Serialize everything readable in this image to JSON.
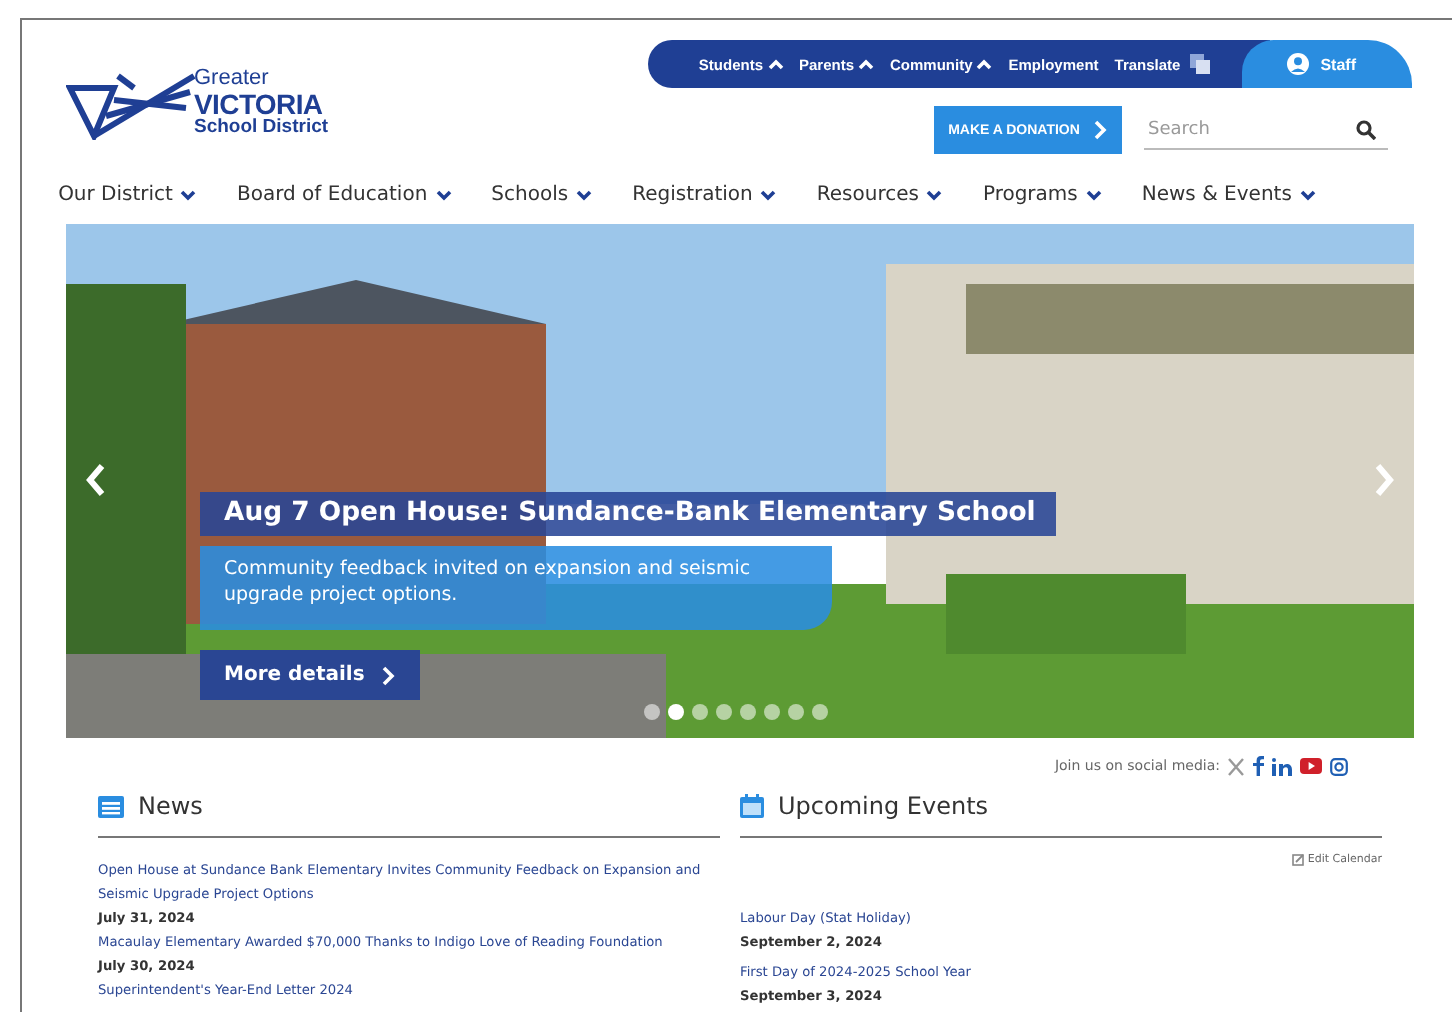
{
  "logo": {
    "line1": "Greater",
    "line2": "VICTORIA",
    "line3": "School District"
  },
  "top_links": [
    {
      "label": "Students",
      "caret": true
    },
    {
      "label": "Parents",
      "caret": true
    },
    {
      "label": "Community",
      "caret": true
    },
    {
      "label": "Employment",
      "caret": false
    },
    {
      "label": "Translate",
      "caret": false
    }
  ],
  "staff_link": "Staff",
  "donate_button": "MAKE A DONATION",
  "search": {
    "placeholder": "Search"
  },
  "main_nav": [
    "Our District",
    "Board of Education",
    "Schools",
    "Registration",
    "Resources",
    "Programs",
    "News & Events"
  ],
  "hero": {
    "title": "Aug 7 Open House: Sundance-Bank Elementary School",
    "subtitle": "Community feedback invited on expansion and seismic upgrade project options.",
    "button": "More details",
    "dots": [
      {
        "selected": false
      },
      {
        "selected": true
      },
      {
        "selected": false
      },
      {
        "selected": false
      },
      {
        "selected": false
      },
      {
        "selected": false
      },
      {
        "selected": false
      },
      {
        "selected": false
      }
    ]
  },
  "social": {
    "label": "Join us on social media:"
  },
  "news": {
    "title": "News",
    "items": [
      {
        "title": "Open House at Sundance Bank Elementary Invites Community Feedback on Expansion and Seismic Upgrade Project Options",
        "date": "July 31, 2024"
      },
      {
        "title": "Macaulay Elementary Awarded $70,000 Thanks to Indigo Love of Reading Foundation",
        "date": "July 30, 2024"
      },
      {
        "title": "Superintendent's Year-End Letter 2024"
      }
    ]
  },
  "events": {
    "title": "Upcoming Events",
    "edit_link": "Edit Calendar",
    "items": [
      {
        "title": "Labour Day (Stat Holiday)",
        "date": "September 2, 2024"
      },
      {
        "title": "First Day of 2024-2025 School Year",
        "date": "September 3, 2024"
      }
    ]
  }
}
